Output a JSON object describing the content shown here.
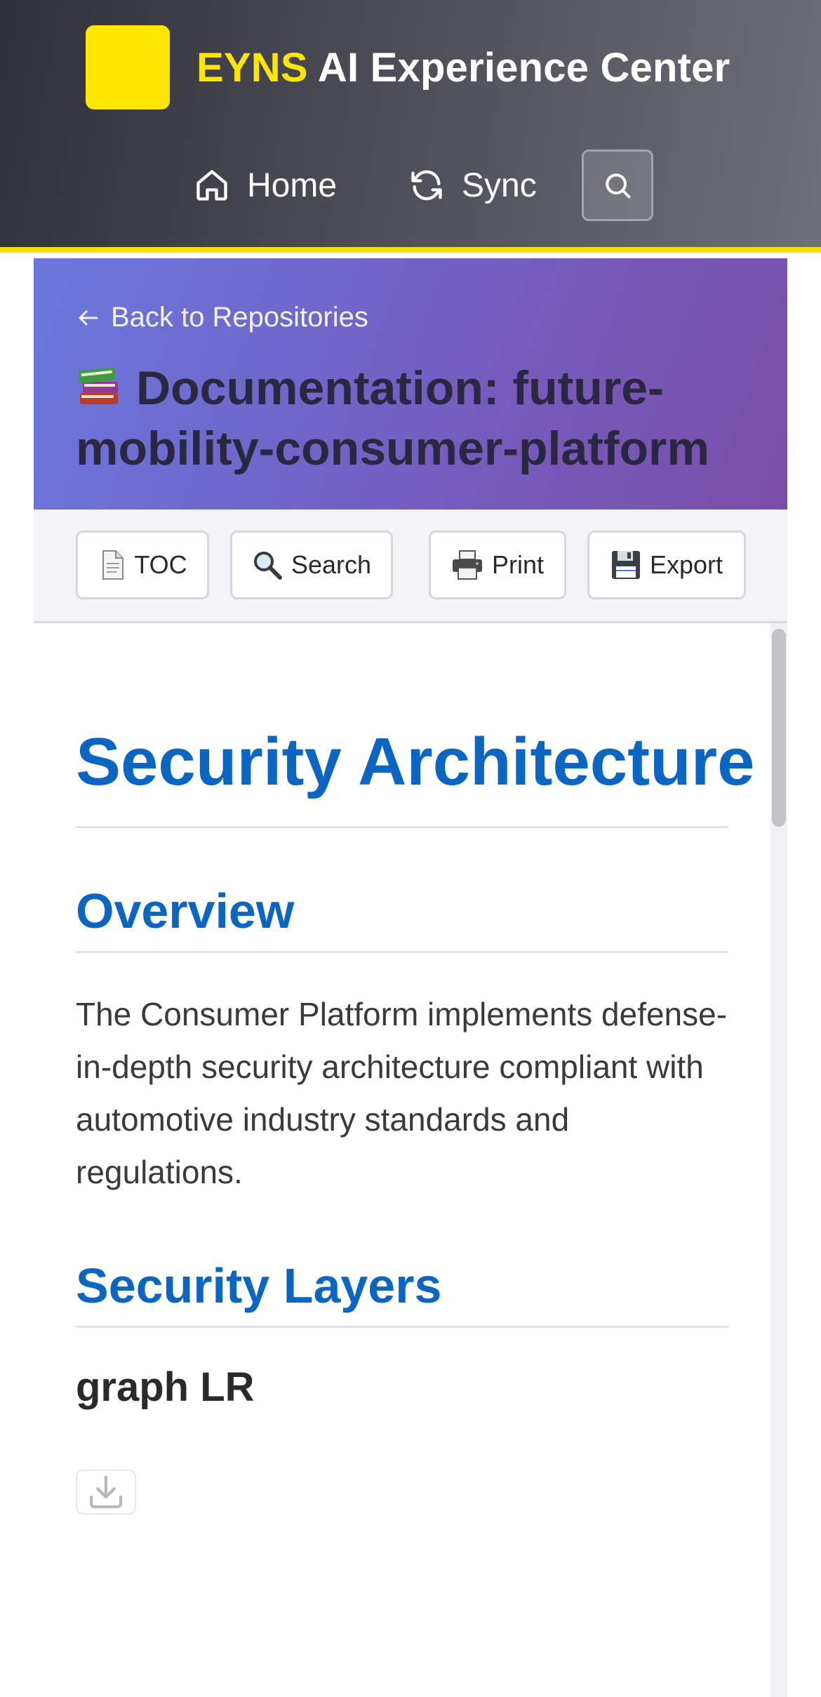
{
  "header": {
    "brand_accent": "EYNS",
    "brand_rest": "AI Experience Center",
    "nav": {
      "home_label": "Home",
      "sync_label": "Sync"
    }
  },
  "doc": {
    "back_label": "Back to Repositories",
    "title": "Documentation: future-mobility-consumer-platform"
  },
  "toolbar": {
    "toc_label": "TOC",
    "search_label": "Search",
    "print_label": "Print",
    "export_label": "Export"
  },
  "content": {
    "h1": "Security Architecture",
    "overview_heading": "Overview",
    "overview_text": "The Consumer Platform implements defense-in-depth security architecture compliant with automotive industry standards and regulations.",
    "layers_heading": "Security Layers",
    "graph_label": "graph LR"
  },
  "colors": {
    "brand_yellow": "#ffe600",
    "heading_blue": "#0b66c3",
    "hero_gradient_start": "#6a78dc",
    "hero_gradient_end": "#7a4ea8"
  },
  "icons": {
    "home": "home-icon",
    "sync": "sync-icon",
    "search": "search-icon",
    "back": "arrow-left-icon",
    "book": "books-icon",
    "toc": "document-icon",
    "toolbar_search": "magnifier-icon",
    "print": "printer-icon",
    "export": "floppy-disk-icon",
    "download": "download-icon"
  }
}
